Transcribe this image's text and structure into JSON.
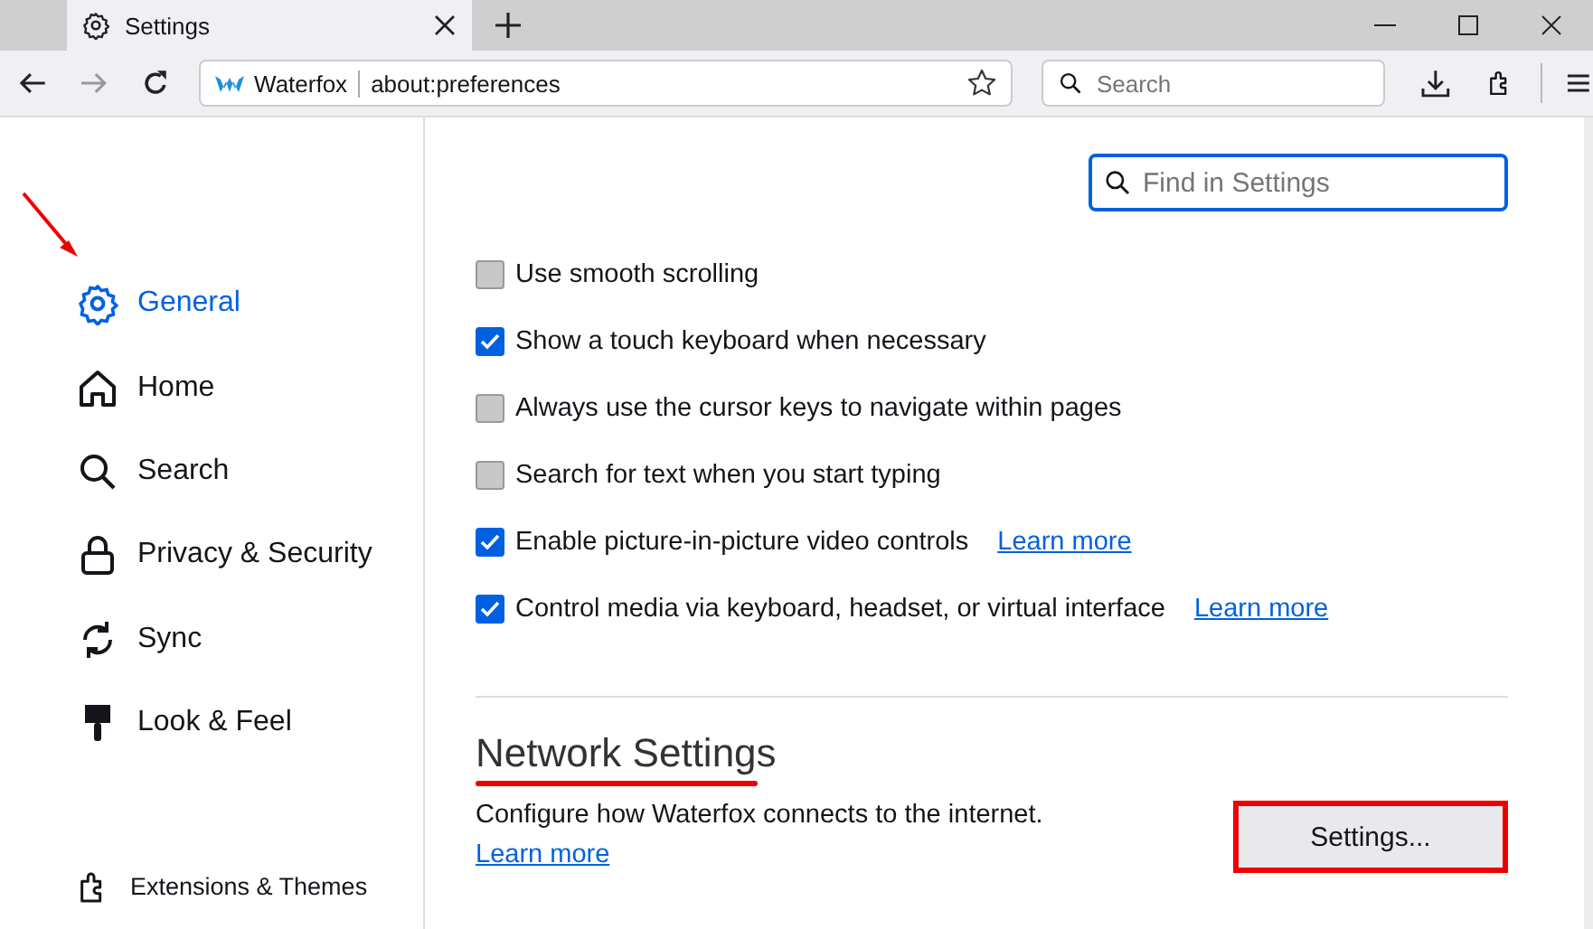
{
  "tab": {
    "title": "Settings",
    "selected": true
  },
  "toolbar": {
    "site_name": "Waterfox",
    "url": "about:preferences",
    "search": {
      "placeholder": "Search"
    }
  },
  "sidebar": {
    "items": [
      {
        "label": "General",
        "selected": true
      },
      {
        "label": "Home",
        "selected": false
      },
      {
        "label": "Search",
        "selected": false
      },
      {
        "label": "Privacy & Security",
        "selected": false
      },
      {
        "label": "Sync",
        "selected": false
      },
      {
        "label": "Look & Feel",
        "selected": false
      }
    ],
    "footer_items": [
      {
        "label": "Extensions & Themes",
        "selected": false
      }
    ]
  },
  "find": {
    "placeholder": "Find in Settings"
  },
  "options": [
    {
      "label": "Use smooth scrolling",
      "checked": false
    },
    {
      "label": "Show a touch keyboard when necessary",
      "checked": true
    },
    {
      "label": "Always use the cursor keys to navigate within pages",
      "checked": false
    },
    {
      "label": "Search for text when you start typing",
      "checked": false
    },
    {
      "label": "Enable picture-in-picture video controls",
      "checked": true,
      "link": "Learn more"
    },
    {
      "label": "Control media via keyboard, headset, or virtual interface",
      "checked": true,
      "link": "Learn more"
    }
  ],
  "network": {
    "heading": "Network Settings",
    "description": "Configure how Waterfox connects to the internet.",
    "link": "Learn more",
    "button": "Settings..."
  }
}
